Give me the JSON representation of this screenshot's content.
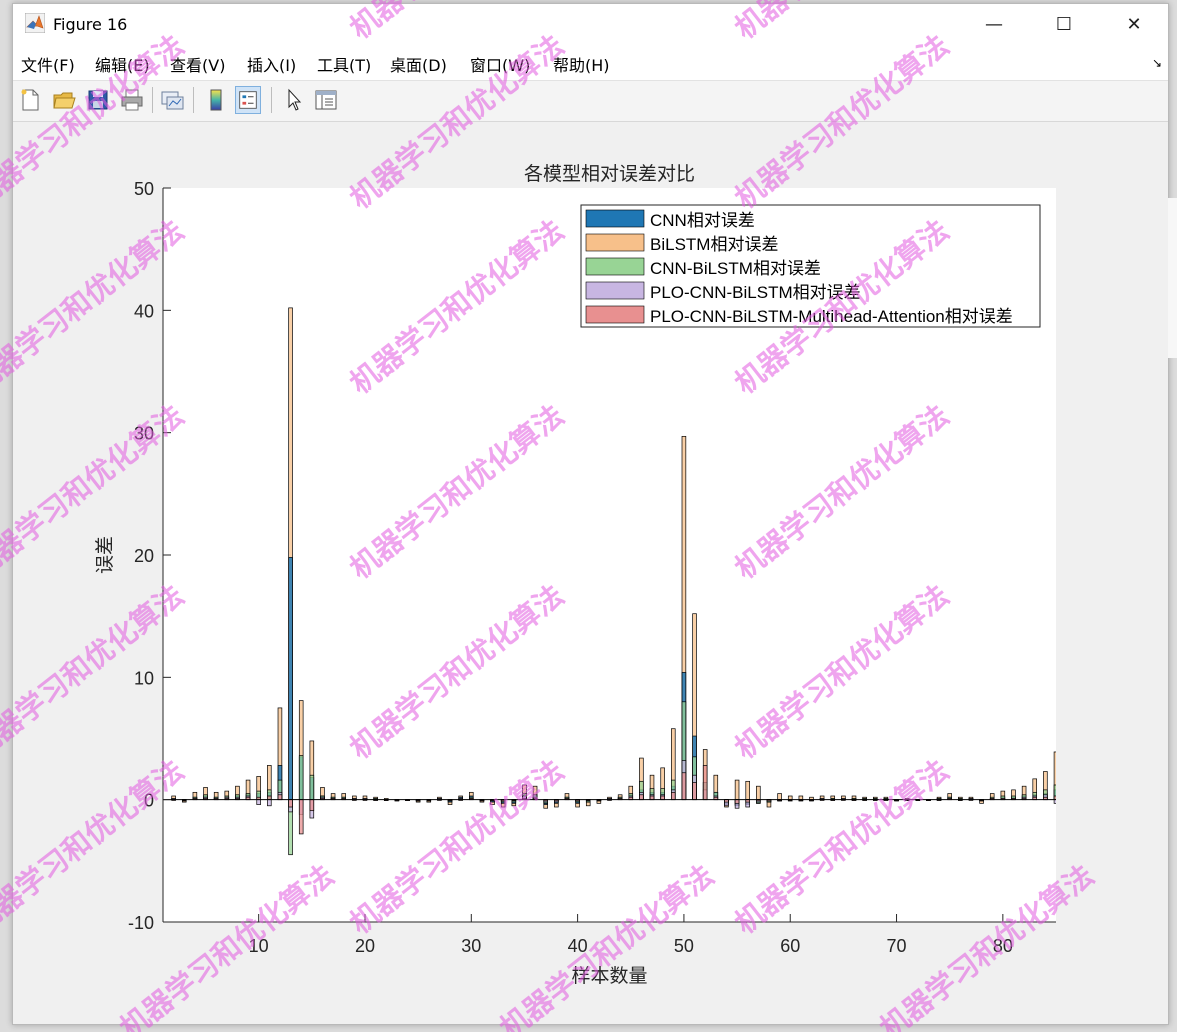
{
  "window": {
    "title": "Figure 16",
    "controls": {
      "minimize": "—",
      "maximize": "☐",
      "close": "✕"
    }
  },
  "menu": [
    "文件(F)",
    "编辑(E)",
    "查看(V)",
    "插入(I)",
    "工具(T)",
    "桌面(D)",
    "窗口(W)",
    "帮助(H)"
  ],
  "toolbar": {
    "icons": [
      "new-figure-icon",
      "open-file-icon",
      "save-icon",
      "print-icon",
      "link-plot-icon",
      "insert-colorbar-icon",
      "insert-legend-icon",
      "edit-plot-icon",
      "property-inspector-icon"
    ],
    "active": "insert-legend-icon"
  },
  "watermark": "机器学习和优化算法",
  "colors": {
    "cnn": "#1f77b4",
    "bilstm": "#f7c08a",
    "cnn_bilstm": "#98d495",
    "plo": "#c8b6e2",
    "attention": "#e89090"
  },
  "chart_data": {
    "type": "bar",
    "title": "各模型相对误差对比",
    "xlabel": "样本数量",
    "ylabel": "误差",
    "xlim": [
      1,
      85
    ],
    "ylim": [
      -10,
      50
    ],
    "xticks": [
      10,
      20,
      30,
      40,
      50,
      60,
      70,
      80
    ],
    "yticks": [
      -10,
      0,
      10,
      20,
      30,
      40,
      50
    ],
    "grid": false,
    "legend_position": "top-right",
    "x": [
      2,
      3,
      4,
      5,
      6,
      7,
      8,
      9,
      10,
      11,
      12,
      13,
      14,
      15,
      16,
      17,
      18,
      19,
      20,
      21,
      22,
      23,
      24,
      25,
      26,
      27,
      28,
      29,
      30,
      31,
      32,
      33,
      34,
      35,
      36,
      37,
      38,
      39,
      40,
      41,
      42,
      43,
      44,
      45,
      46,
      47,
      48,
      49,
      50,
      51,
      52,
      53,
      54,
      55,
      56,
      57,
      58,
      59,
      60,
      61,
      62,
      63,
      64,
      65,
      66,
      67,
      68,
      69,
      70,
      71,
      72,
      73,
      74,
      75,
      76,
      77,
      78,
      79,
      80,
      81,
      82,
      83,
      84,
      85
    ],
    "series": [
      {
        "name": "CNN相对误差",
        "color": "cnn",
        "values": [
          0.1,
          -0.1,
          0.2,
          0.3,
          0.2,
          0.2,
          0.3,
          0.4,
          0.5,
          0.6,
          2.8,
          19.8,
          3.5,
          1.8,
          0.3,
          0.2,
          0.2,
          0.1,
          0.1,
          0.1,
          0.0,
          -0.1,
          0.0,
          -0.1,
          -0.1,
          0.1,
          -0.2,
          0.2,
          0.3,
          -0.1,
          -0.2,
          -0.3,
          -0.3,
          0.4,
          0.4,
          -0.4,
          -0.3,
          0.2,
          -0.3,
          -0.2,
          -0.1,
          0.1,
          0.2,
          0.4,
          0.8,
          0.6,
          0.6,
          1.1,
          10.4,
          5.2,
          1.4,
          0.6,
          -0.4,
          -0.5,
          -0.4,
          -0.3,
          -0.2,
          -0.1,
          -0.1,
          -0.1,
          -0.1,
          0.1,
          0.1,
          0.1,
          0.1,
          0.1,
          0.1,
          0.1,
          -0.1,
          0.0,
          0.0,
          0.0,
          0.1,
          0.2,
          0.1,
          0.1,
          -0.1,
          0.1,
          0.2,
          0.2,
          0.3,
          0.4,
          0.5,
          0.8
        ]
      },
      {
        "name": "BiLSTM相对误差",
        "color": "bilstm",
        "values": [
          0.3,
          -0.2,
          0.6,
          1.0,
          0.6,
          0.7,
          1.1,
          1.6,
          1.9,
          2.8,
          7.5,
          40.2,
          8.1,
          4.8,
          1.0,
          0.5,
          0.5,
          0.3,
          0.3,
          0.2,
          0.1,
          -0.1,
          0.0,
          -0.2,
          -0.2,
          0.2,
          -0.4,
          0.3,
          0.6,
          -0.2,
          -0.4,
          -0.6,
          -0.5,
          1.2,
          1.1,
          -0.7,
          -0.6,
          0.5,
          -0.6,
          -0.5,
          -0.3,
          0.2,
          0.4,
          1.1,
          3.4,
          2.0,
          2.6,
          5.8,
          29.7,
          15.2,
          4.1,
          2.0,
          -0.6,
          1.6,
          1.5,
          1.1,
          -0.6,
          0.5,
          0.3,
          0.3,
          0.2,
          0.3,
          0.3,
          0.3,
          0.3,
          0.2,
          0.2,
          0.2,
          -0.1,
          0.1,
          0.0,
          0.0,
          0.2,
          0.5,
          0.2,
          0.2,
          -0.3,
          0.5,
          0.7,
          0.8,
          1.1,
          1.7,
          2.3,
          3.9
        ]
      },
      {
        "name": "CNN-BiLSTM相对误差",
        "color": "cnn_bilstm",
        "values": [
          0.1,
          -0.1,
          0.2,
          0.4,
          0.2,
          0.3,
          0.4,
          0.5,
          0.7,
          0.8,
          1.6,
          -4.5,
          3.6,
          2.0,
          0.3,
          0.2,
          0.2,
          0.1,
          0.1,
          0.1,
          0.0,
          0.0,
          0.0,
          -0.1,
          -0.1,
          0.1,
          -0.1,
          0.1,
          0.2,
          -0.1,
          -0.1,
          -0.2,
          -0.2,
          0.5,
          0.4,
          -0.3,
          -0.2,
          0.2,
          -0.2,
          -0.2,
          -0.1,
          0.1,
          0.2,
          0.5,
          1.5,
          0.9,
          0.9,
          1.6,
          8.0,
          3.5,
          1.4,
          0.6,
          -0.3,
          -0.4,
          -0.3,
          -0.3,
          -0.2,
          -0.1,
          -0.1,
          -0.1,
          -0.1,
          0.1,
          0.1,
          0.1,
          0.1,
          0.1,
          0.1,
          0.1,
          0.0,
          0.0,
          0.0,
          0.0,
          0.1,
          0.2,
          0.1,
          0.1,
          -0.1,
          0.2,
          0.3,
          0.3,
          0.4,
          0.6,
          0.8,
          1.2
        ]
      },
      {
        "name": "PLO-CNN-BiLSTM相对误差",
        "color": "plo",
        "values": [
          0.1,
          0.0,
          0.1,
          0.2,
          0.1,
          0.2,
          0.2,
          0.3,
          -0.4,
          -0.5,
          0.6,
          -1.0,
          -1.2,
          -1.5,
          0.2,
          0.1,
          0.1,
          0.1,
          0.1,
          0.0,
          0.0,
          0.0,
          0.0,
          -0.1,
          0.0,
          0.1,
          -0.1,
          0.1,
          0.1,
          0.0,
          -0.1,
          -0.1,
          -0.1,
          0.3,
          0.2,
          -0.2,
          -0.2,
          0.1,
          -0.1,
          -0.1,
          0.0,
          0.1,
          0.1,
          0.3,
          0.6,
          0.4,
          0.4,
          0.8,
          3.2,
          2.0,
          0.8,
          0.3,
          -0.5,
          -0.7,
          -0.6,
          -0.2,
          -0.1,
          -0.1,
          0.0,
          0.0,
          0.0,
          0.1,
          0.0,
          0.1,
          0.0,
          0.0,
          0.0,
          0.0,
          0.0,
          0.0,
          0.0,
          0.0,
          0.0,
          0.1,
          0.0,
          0.1,
          0.0,
          0.1,
          0.1,
          0.1,
          0.2,
          0.3,
          0.4,
          -0.3
        ]
      },
      {
        "name": "PLO-CNN-BiLSTM-Multihead-Attention相对误差",
        "color": "attention",
        "values": [
          0.0,
          0.0,
          0.1,
          0.1,
          0.1,
          0.1,
          0.1,
          0.2,
          0.2,
          0.3,
          0.4,
          -0.6,
          -2.8,
          -0.9,
          0.1,
          0.1,
          0.1,
          0.0,
          0.0,
          0.0,
          0.0,
          0.0,
          0.0,
          0.0,
          0.0,
          0.0,
          0.0,
          0.0,
          0.1,
          0.0,
          0.0,
          -0.1,
          0.0,
          0.1,
          0.1,
          -0.1,
          -0.1,
          0.1,
          -0.1,
          0.0,
          0.0,
          0.0,
          0.1,
          0.2,
          0.4,
          0.3,
          0.3,
          0.6,
          2.2,
          1.4,
          2.8,
          0.2,
          -0.2,
          -0.3,
          -0.2,
          -0.1,
          -0.1,
          0.0,
          0.0,
          0.0,
          0.0,
          0.0,
          0.0,
          0.0,
          0.0,
          0.0,
          0.0,
          0.0,
          0.0,
          0.0,
          0.0,
          0.0,
          0.0,
          0.1,
          0.0,
          0.0,
          0.0,
          0.1,
          0.1,
          0.1,
          0.1,
          0.2,
          0.2,
          0.3
        ]
      }
    ]
  }
}
